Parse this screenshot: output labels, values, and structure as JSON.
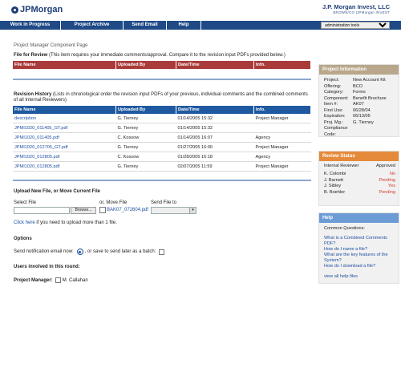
{
  "header": {
    "logo_text": "JPMorgan",
    "brand_title": "J.P. Morgan Invest, LLC",
    "brand_sub": "BROWN/CO   |JPMorgan INVEST"
  },
  "nav": {
    "tabs": [
      "Work in Progress",
      "Project Archive",
      "Send Email",
      "Help"
    ],
    "tools_value": "administration tools"
  },
  "main": {
    "page_title": "Project Manager Component Page",
    "review": {
      "heading": "File for Review",
      "note": "(This item requires your immediate comments/approval. Compare it to the revision input PDFs provided below.)",
      "columns": [
        "File Name",
        "Uploaded By",
        "Date/Time",
        "Info."
      ]
    },
    "history": {
      "heading": "Revision History",
      "note": "(Lists in chronological order the revision input PDFs of your previous, individual comments and the combined comments of all Internal Reviewers)",
      "columns": [
        "File Name",
        "Uploaded By",
        "Date/Time",
        "Info."
      ],
      "rows": [
        [
          "description",
          "G. Tierney",
          "01/14/2005 15:32",
          "Project Manager"
        ],
        [
          "JPMI1020_011405_GT.pdf",
          "G. Tierney",
          "01/14/2005 15:32",
          ""
        ],
        [
          "JPMI1020_011405.pdf",
          "C. Kossow",
          "01/14/2005 16:07",
          "Agency"
        ],
        [
          "JPMI1020_012705_GT.pdf",
          "G. Tierney",
          "01/27/2005 16:00",
          "Project Manager"
        ],
        [
          "JPMI1020_012805.pdf",
          "C. Kossow",
          "01/28/2005 16:18",
          "Agency"
        ],
        [
          "JPMI1020_012805.pdf",
          "G. Tierney",
          "02/07/2005 11:59",
          "Project Manager"
        ]
      ]
    },
    "upload": {
      "heading": "Upload New File, or Move Current File",
      "select_label": "Select File",
      "move_label": "or, Move File",
      "send_label": "Send File to",
      "browse": "Browse...",
      "move_file": "BAK07_072604.pdf",
      "help_link": "Click here",
      "help_rest": " if you need to upload more than 1 file."
    },
    "options": {
      "heading": "Options",
      "notify_label": "Send notification email now:",
      "later_label": ", or save to send later as a batch:"
    },
    "users": {
      "heading": "Users involved in this round:",
      "pm_label": "Project Manager:",
      "pm_name": "M. Callahan"
    }
  },
  "project_info": {
    "title": "Project Information",
    "rows": [
      [
        "Project:",
        "New Account Kit"
      ],
      [
        "Offering:",
        "BCO"
      ],
      [
        "Category:",
        "Forms"
      ],
      [
        "Component:",
        "Benefit Brochure"
      ],
      [
        "Item #:",
        "AK07"
      ],
      [
        "First Use:",
        "06/28/04"
      ],
      [
        "Expiration:",
        "06/13/05"
      ],
      [
        "Proj. Mg.:",
        "G. Tierney"
      ],
      [
        "Compliance Code:",
        ""
      ]
    ]
  },
  "review_status": {
    "title": "Review Status",
    "col1": "Internal Reviewer",
    "col2": "Approved",
    "rows": [
      {
        "name": "K. Colombi",
        "status": "No",
        "color": "#d23a2a"
      },
      {
        "name": "J. Barnett",
        "status": "Pending",
        "color": "#d23a2a"
      },
      {
        "name": "J. Sibley",
        "status": "Yes",
        "color": "#d23a2a"
      },
      {
        "name": "B. Boehler",
        "status": "Pending",
        "color": "#d23a2a"
      }
    ]
  },
  "help": {
    "title": "Help",
    "heading": "Common Questions:",
    "links": [
      "What is a Combined Comments PDF?",
      "How do I name a file?",
      "What are the key features of the System?",
      "How do I download a file?"
    ],
    "all_link": "view all help files"
  },
  "colors": {
    "nav": "#1f4a86",
    "review_header": "#a93b3a",
    "history_header": "#1f5aa0",
    "project_info": "#b8a78b",
    "review_status": "#e58a3a",
    "help": "#6c9bd6"
  }
}
